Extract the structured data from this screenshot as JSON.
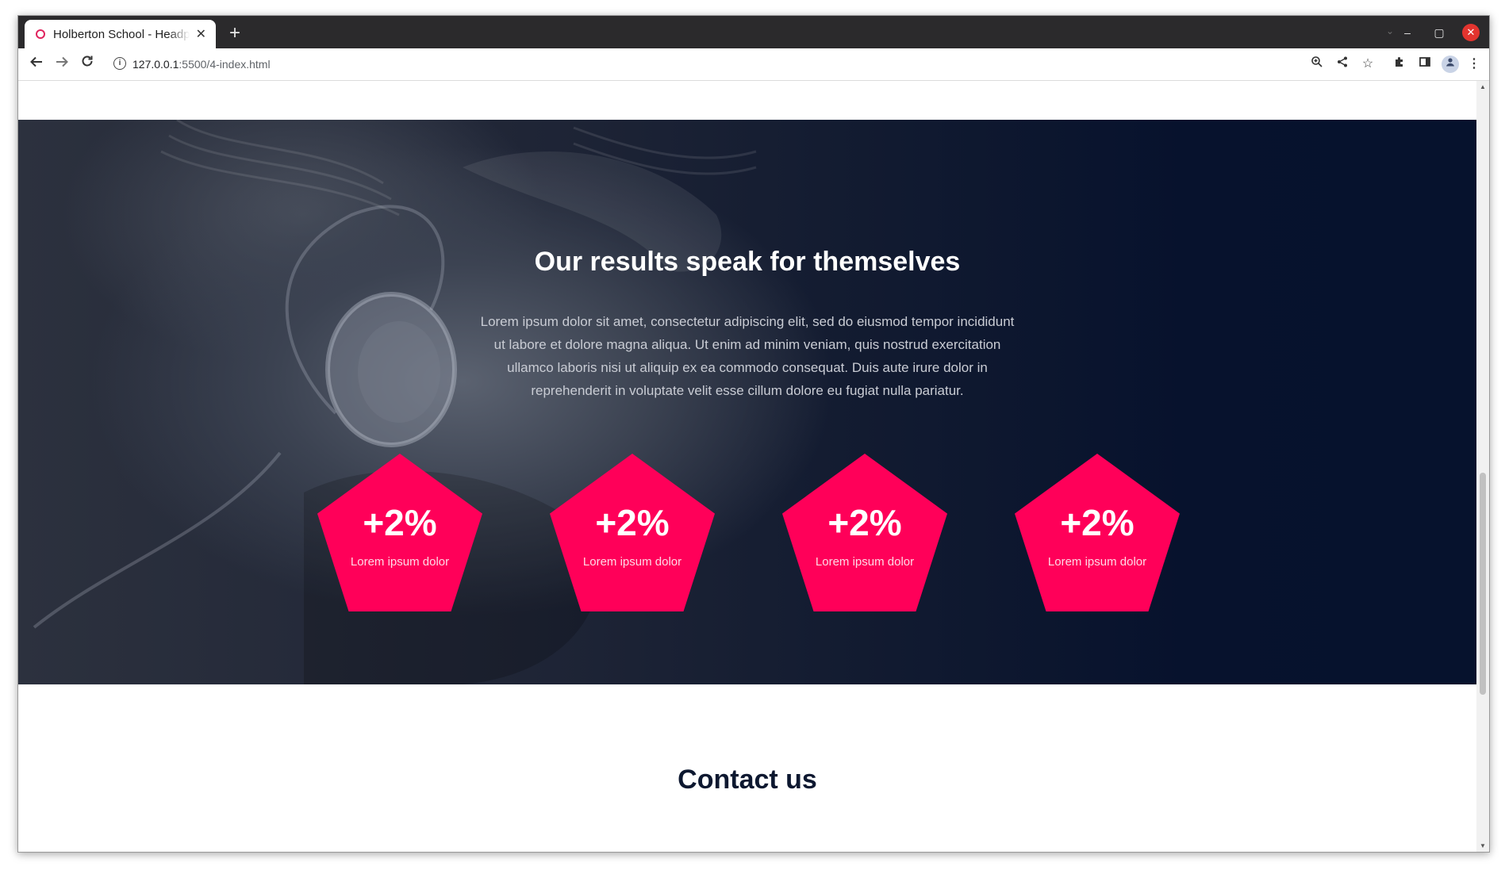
{
  "browser": {
    "tab_title": "Holberton School - Headphones",
    "url_host": "127.0.0.1",
    "url_path": ":5500/4-index.html"
  },
  "section_results": {
    "title": "Our results speak for themselves",
    "paragraph": "Lorem ipsum dolor sit amet, consectetur adipiscing elit, sed do eiusmod tempor incididunt ut labore et dolore magna aliqua. Ut enim ad minim veniam, quis nostrud exercitation ullamco laboris nisi ut aliquip ex ea commodo consequat. Duis aute irure dolor in reprehenderit in voluptate velit esse cillum dolore eu fugiat nulla pariatur.",
    "stats": [
      {
        "value": "+2%",
        "label": "Lorem ipsum dolor"
      },
      {
        "value": "+2%",
        "label": "Lorem ipsum dolor"
      },
      {
        "value": "+2%",
        "label": "Lorem ipsum dolor"
      },
      {
        "value": "+2%",
        "label": "Lorem ipsum dolor"
      }
    ]
  },
  "section_contact": {
    "title": "Contact us"
  },
  "colors": {
    "accent": "#ff0059",
    "hero_dark": "#06122d",
    "heading_dark": "#0d1830"
  },
  "icons": {
    "tab_favicon": "favicon-icon",
    "tab_close": "close-icon",
    "new_tab": "plus-icon",
    "back": "arrow-left-icon",
    "forward": "arrow-right-icon",
    "reload": "reload-icon",
    "site_info": "info-icon",
    "zoom": "zoom-icon",
    "share": "share-icon",
    "bookmark": "star-icon",
    "extensions": "puzzle-icon",
    "side_panel": "side-panel-icon",
    "profile": "profile-icon",
    "menu": "kebab-menu-icon"
  }
}
